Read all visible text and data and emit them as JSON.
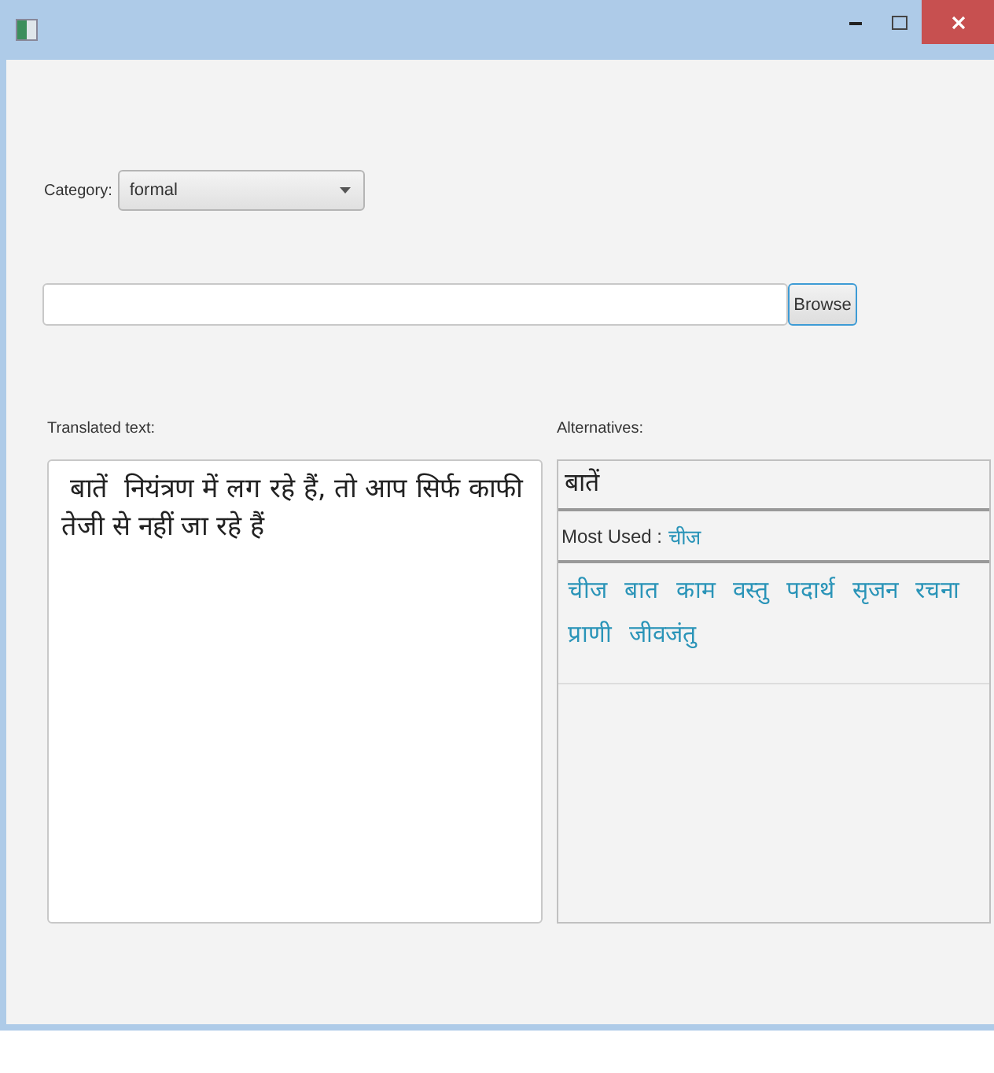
{
  "category": {
    "label": "Category:",
    "value": "formal"
  },
  "file": {
    "button": "Browse"
  },
  "translated": {
    "label": "Translated text:",
    "text": " बातें  नियंत्रण में लग रहे हैं, तो आप सिर्फ काफी तेजी से नहीं जा रहे हैं"
  },
  "alternatives": {
    "label": "Alternatives:",
    "word": "बातें",
    "most_used_label": "Most Used :",
    "most_used": "चीज",
    "options": [
      "चीज",
      "बात",
      "काम",
      "वस्तु",
      "पदार्थ",
      "सृजन",
      "रचना",
      "प्राणी",
      "जीवजंतु"
    ]
  }
}
